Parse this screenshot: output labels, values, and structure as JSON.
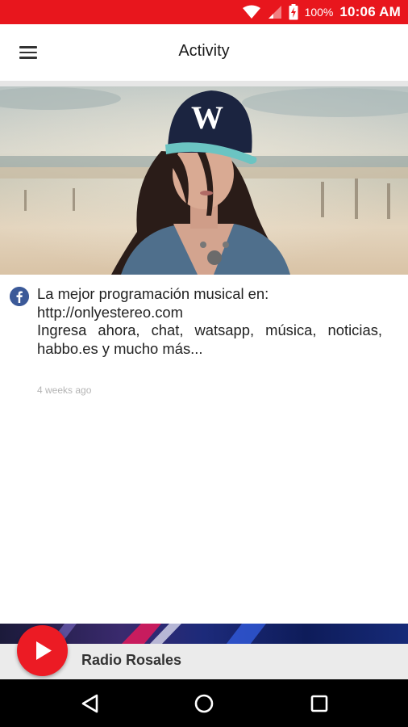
{
  "status_bar": {
    "battery": "100%",
    "time": "10:06 AM",
    "icons": [
      "wifi-icon",
      "signal-icon",
      "battery-charging-icon"
    ]
  },
  "app_bar": {
    "title": "Activity",
    "menu_icon": "hamburger-menu-icon"
  },
  "post": {
    "source_icon": "facebook-icon",
    "lines": [
      "La mejor programación musical en:",
      "http://onlyestereo.com",
      "Ingresa ahora, chat, watsapp, música, noticias,",
      "habbo.es y mucho más..."
    ],
    "timestamp": "4 weeks ago"
  },
  "player": {
    "station": "Radio Rosales",
    "play_icon": "play-icon"
  },
  "nav": {
    "back_icon": "back-icon",
    "home_icon": "home-icon",
    "recents_icon": "recents-icon"
  },
  "colors": {
    "accent": "#e8161d",
    "facebook": "#3b5998",
    "play_button": "#ec1b24"
  }
}
